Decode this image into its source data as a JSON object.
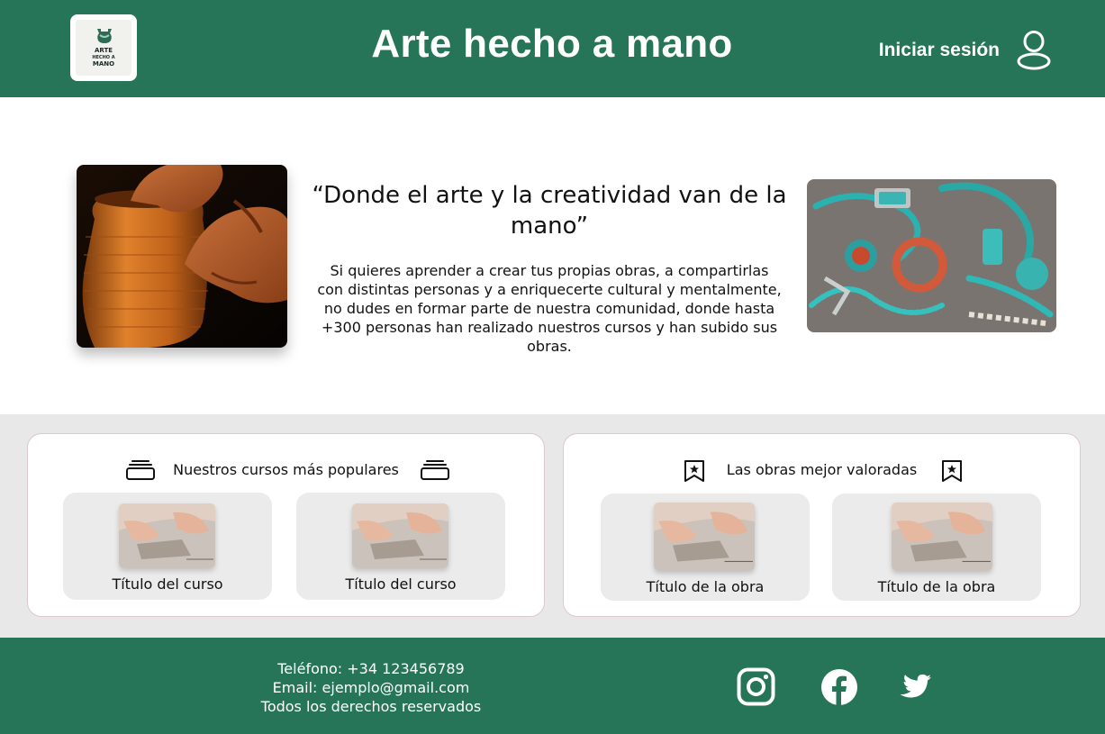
{
  "header": {
    "logo": {
      "line1": "ARTE",
      "line2": "HECHO A",
      "line3": "MANO"
    },
    "title": "Arte hecho a mano",
    "login_label": "Iniciar sesión",
    "user_icon": "user-icon"
  },
  "hero": {
    "quote": "“Donde el arte y la creatividad van de la mano”",
    "text": "Si quieres aprender a crear tus propias obras, a compartirlas con distintas personas y a enriquecerte cultural y mentalmente, no dudes en formar parte de nuestra comunidad, donde hasta +300 personas han realizado nuestros cursos y han subido sus obras.",
    "images": [
      "pottery-wheel-photo",
      "turquoise-jewelry-photo"
    ]
  },
  "sections": {
    "courses": {
      "title": "Nuestros cursos más populares",
      "icon": "stack-icon",
      "cards": [
        {
          "label": "Título del curso"
        },
        {
          "label": "Título del curso"
        }
      ]
    },
    "works": {
      "title": "Las obras mejor valoradas",
      "icon": "bookmark-star-icon",
      "cards": [
        {
          "label": "Título de la obra"
        },
        {
          "label": "Título de la obra"
        }
      ]
    }
  },
  "footer": {
    "phone": "Teléfono: +34 123456789",
    "email": "Email: ejemplo@gmail.com",
    "rights": "Todos los derechos reservados",
    "social": [
      "instagram-icon",
      "facebook-icon",
      "twitter-icon"
    ]
  },
  "colors": {
    "brand_green": "#267559",
    "band_gray": "#e8e8e8",
    "card_gray": "#ebebeb",
    "text": "#111111"
  }
}
